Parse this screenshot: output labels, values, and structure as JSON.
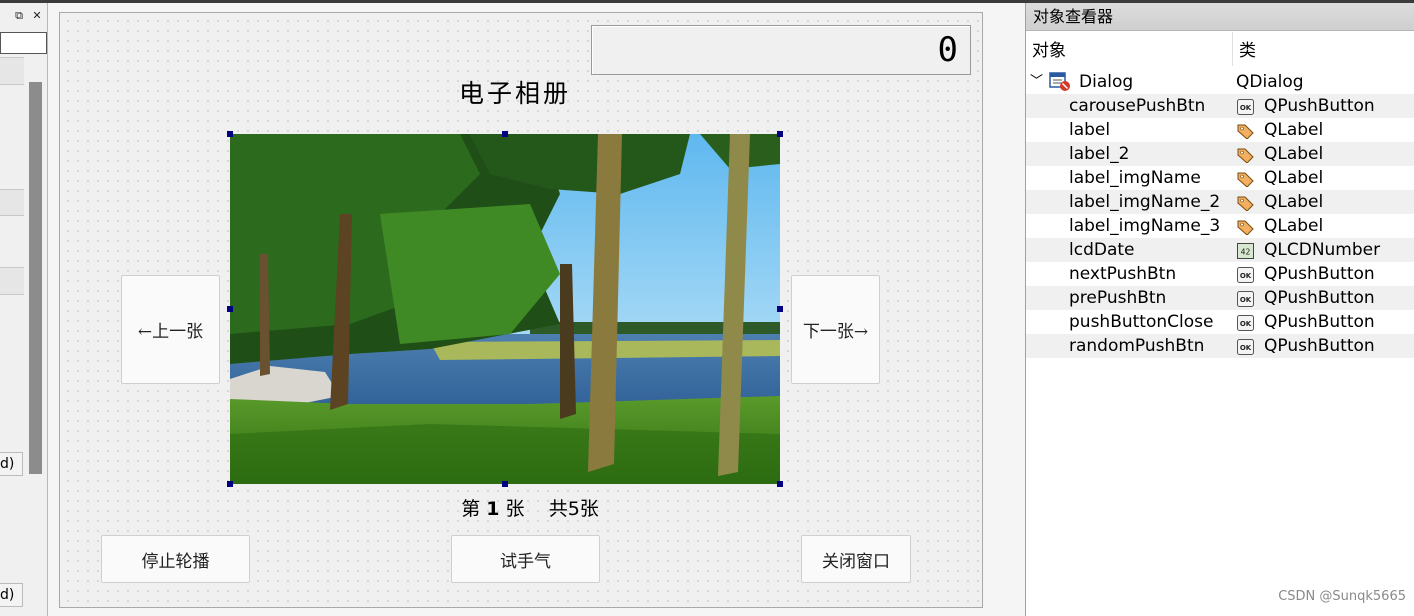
{
  "designer": {
    "lcd_value": "0",
    "title": "电子相册",
    "prev_button": "←上一张",
    "next_button": "下一张→",
    "counter": {
      "prefix": "第",
      "index": "1",
      "suffix": "张",
      "total": "共5张"
    },
    "stop_carousel_button": "停止轮播",
    "luck_button": "试手气",
    "close_button": "关闭窗口"
  },
  "left_dock": {
    "float_icon": "restore-icon",
    "close_icon": "close-icon",
    "fragment_1": "d)",
    "fragment_2": "d)"
  },
  "object_inspector": {
    "title": "对象查看器",
    "columns": {
      "object": "对象",
      "class": "类"
    },
    "root": {
      "name": "Dialog",
      "class": "QDialog",
      "icon": "dialog-icon"
    },
    "children": [
      {
        "name": "carousePushBtn",
        "class": "QPushButton",
        "icon": "pushbutton-icon"
      },
      {
        "name": "label",
        "class": "QLabel",
        "icon": "label-icon"
      },
      {
        "name": "label_2",
        "class": "QLabel",
        "icon": "label-icon"
      },
      {
        "name": "label_imgName",
        "class": "QLabel",
        "icon": "label-icon"
      },
      {
        "name": "label_imgName_2",
        "class": "QLabel",
        "icon": "label-icon"
      },
      {
        "name": "label_imgName_3",
        "class": "QLabel",
        "icon": "label-icon"
      },
      {
        "name": "lcdDate",
        "class": "QLCDNumber",
        "icon": "lcdnumber-icon"
      },
      {
        "name": "nextPushBtn",
        "class": "QPushButton",
        "icon": "pushbutton-icon"
      },
      {
        "name": "prePushBtn",
        "class": "QPushButton",
        "icon": "pushbutton-icon"
      },
      {
        "name": "pushButtonClose",
        "class": "QPushButton",
        "icon": "pushbutton-icon"
      },
      {
        "name": "randomPushBtn",
        "class": "QPushButton",
        "icon": "pushbutton-icon"
      }
    ]
  },
  "watermark": "CSDN @Sunqk5665"
}
